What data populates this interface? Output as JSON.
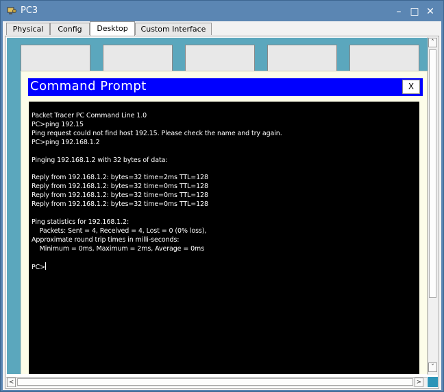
{
  "window": {
    "title": "PC3",
    "minimize_glyph": "–",
    "maximize_glyph": "□",
    "close_glyph": "✕"
  },
  "tabs": [
    {
      "label": "Physical"
    },
    {
      "label": "Config"
    },
    {
      "label": "Desktop"
    },
    {
      "label": "Custom Interface"
    }
  ],
  "active_tab": "Desktop",
  "command_prompt": {
    "title": "Command Prompt",
    "close_label": "X",
    "lines": [
      "Packet Tracer PC Command Line 1.0",
      "PC>ping 192.15",
      "Ping request could not find host 192.15. Please check the name and try again.",
      "PC>ping 192.168.1.2",
      "",
      "Pinging 192.168.1.2 with 32 bytes of data:",
      "",
      "Reply from 192.168.1.2: bytes=32 time=2ms TTL=128",
      "Reply from 192.168.1.2: bytes=32 time=0ms TTL=128",
      "Reply from 192.168.1.2: bytes=32 time=0ms TTL=128",
      "Reply from 192.168.1.2: bytes=32 time=0ms TTL=128",
      "",
      "Ping statistics for 192.168.1.2:",
      "    Packets: Sent = 4, Received = 4, Lost = 0 (0% loss),",
      "Approximate round trip times in milli-seconds:",
      "    Minimum = 0ms, Maximum = 2ms, Average = 0ms",
      ""
    ],
    "prompt": "PC>"
  },
  "scrollbar": {
    "up_glyph": "˄",
    "down_glyph": "˅",
    "left_glyph": "<",
    "right_glyph": ">"
  },
  "colors": {
    "window_frame": "#5b86b3",
    "prompt_title_bar": "#0000ff",
    "terminal_bg": "#000000",
    "terminal_text": "#ffffff",
    "desktop_bg": "#5ba7bd"
  },
  "icons": [
    "app-icon",
    "minimize-icon",
    "maximize-icon",
    "close-icon"
  ]
}
